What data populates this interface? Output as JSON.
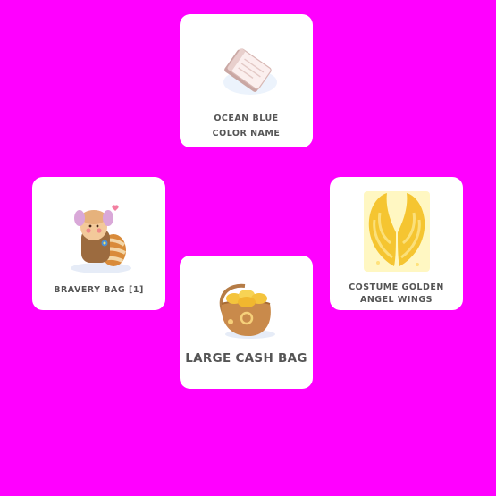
{
  "rewards": [
    {
      "label_lines": [
        "OCEAN BLUE",
        "COLOR NAME"
      ],
      "icon": "color-name-book-icon"
    },
    {
      "label_lines": [
        "BRAVERY BAG [1]"
      ],
      "icon": "bravery-bag-cookie-icon"
    },
    {
      "label_lines": [
        "COSTUME GOLDEN",
        "ANGEL WINGS"
      ],
      "icon": "golden-angel-wings-icon"
    },
    {
      "label_lines": [
        "LARGE CASH BAG"
      ],
      "icon": "large-cash-bag-icon"
    }
  ],
  "colors": {
    "background": "#ff00ff",
    "card": "#ffffff",
    "label_text": "#555555"
  }
}
